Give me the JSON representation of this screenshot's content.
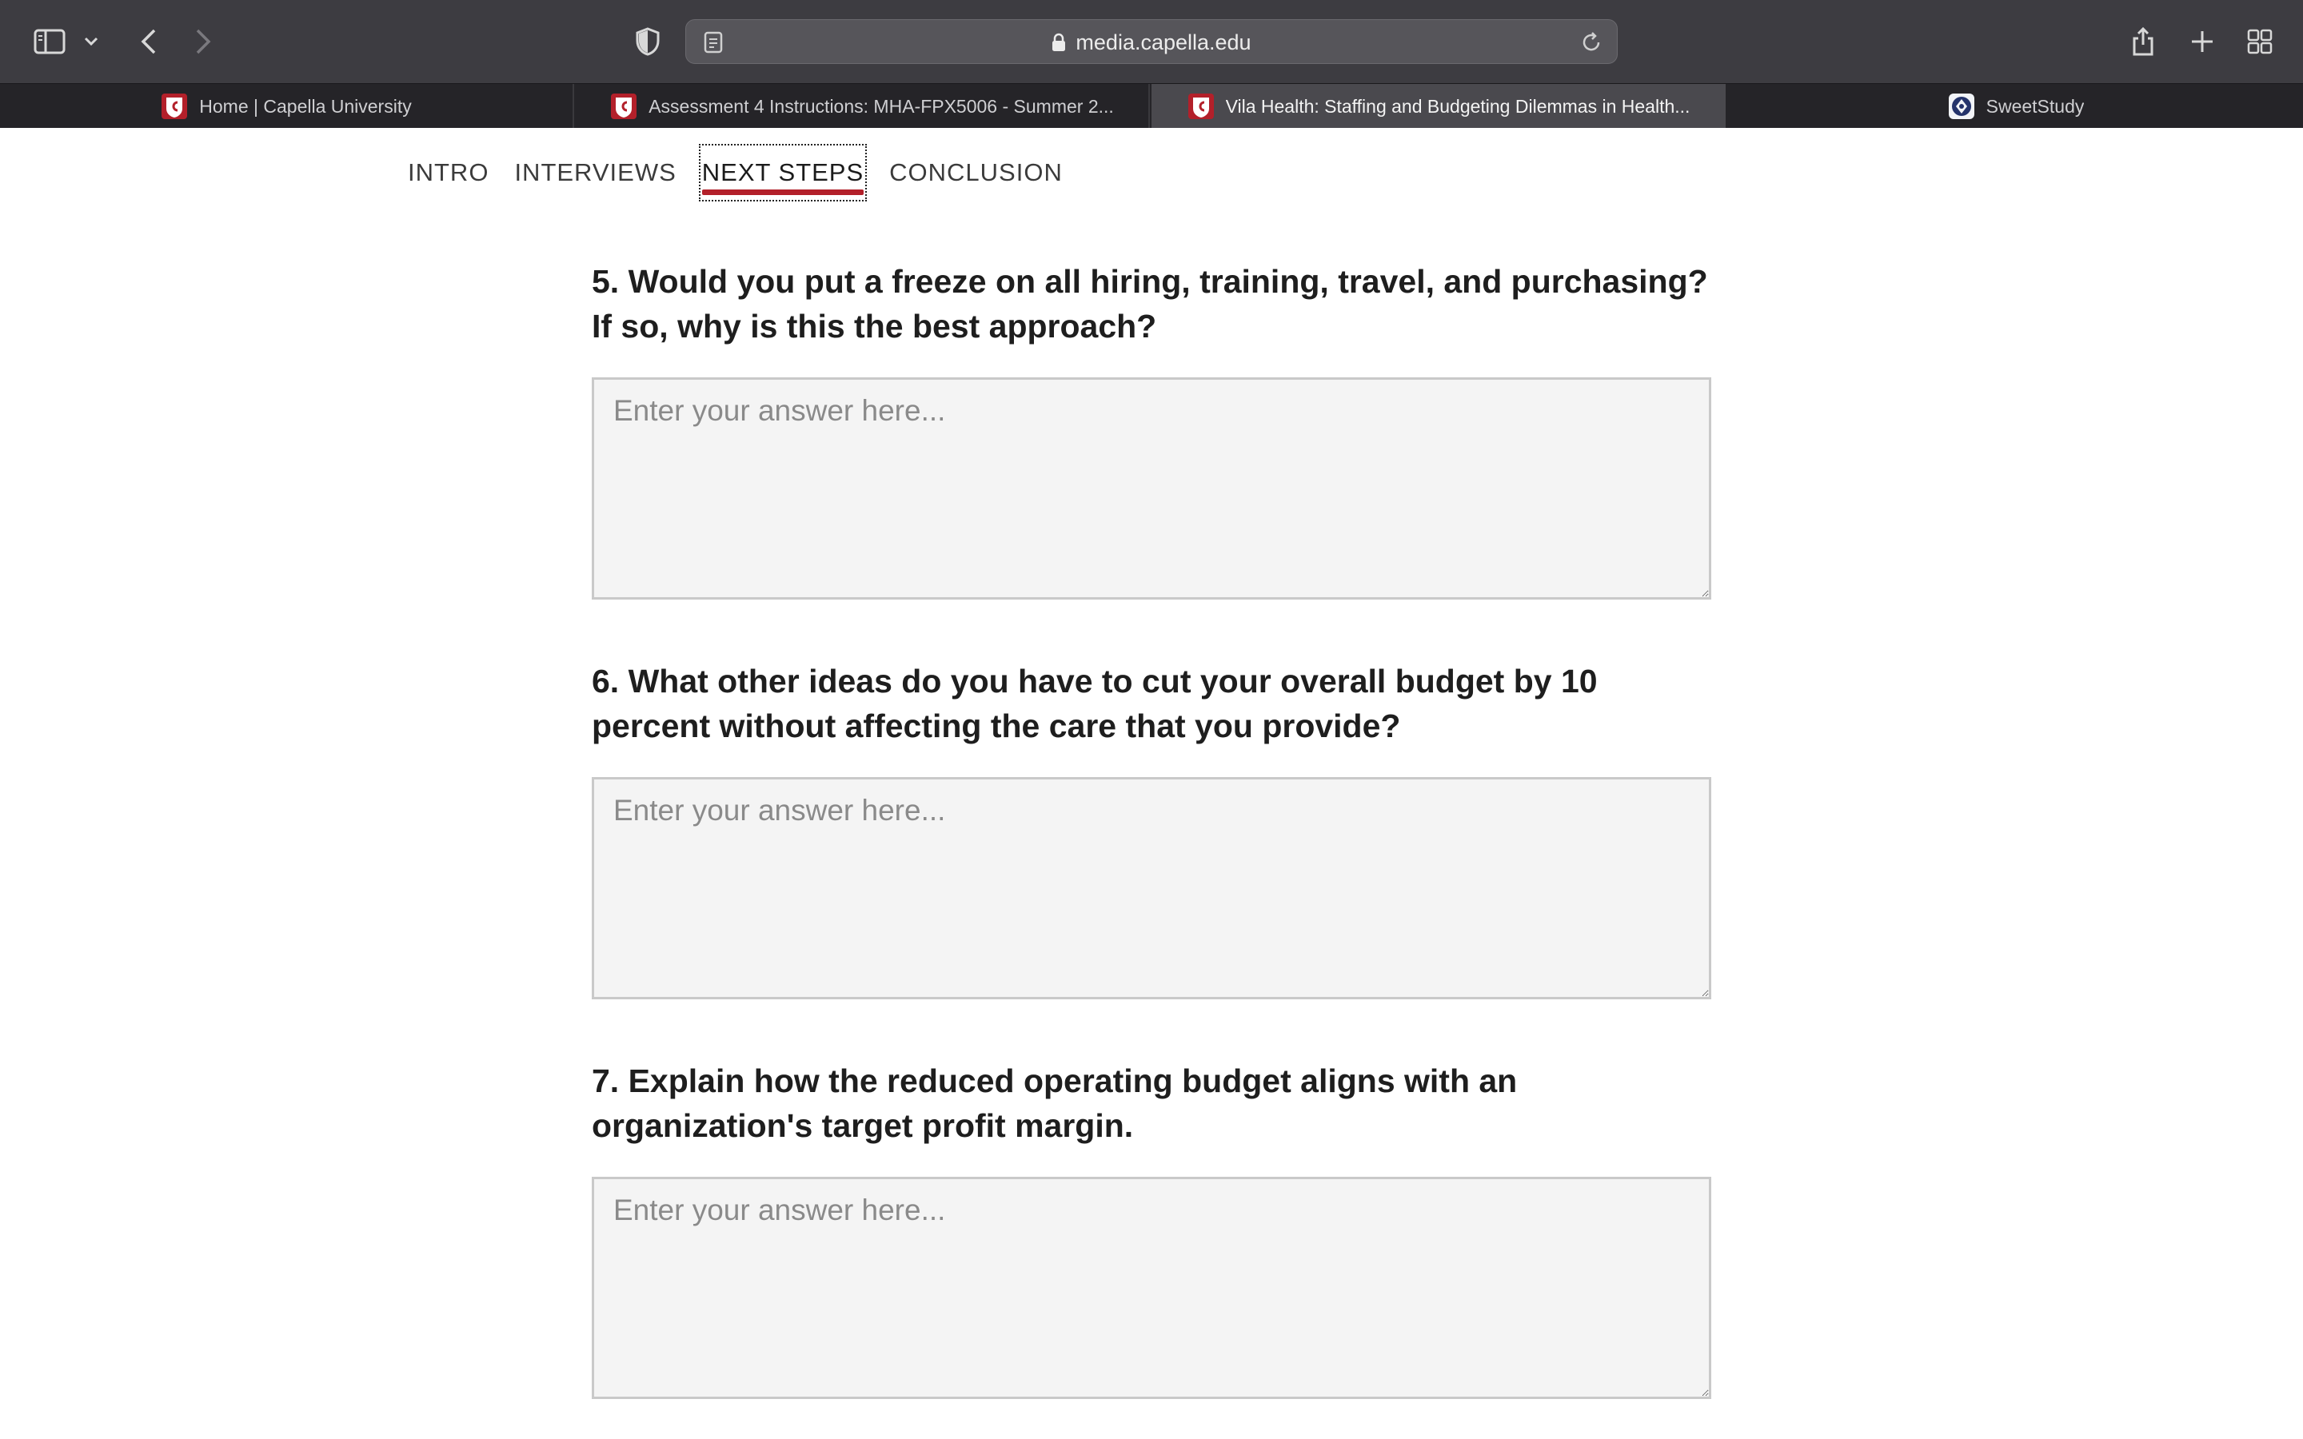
{
  "browser": {
    "url": "media.capella.edu",
    "icons": {
      "sidebar": "sidebar-icon",
      "chevron": "chevron-down-icon",
      "back": "back-arrow-icon",
      "forward": "forward-arrow-icon",
      "shield": "privacy-shield-icon",
      "reader": "page-icon",
      "lock": "lock-icon",
      "reload": "reload-icon",
      "share": "share-icon",
      "new_tab": "plus-icon",
      "tab_overview": "grid-icon"
    }
  },
  "tabs": [
    {
      "title": "Home | Capella University",
      "icon": "capella-favicon"
    },
    {
      "title": "Assessment 4 Instructions: MHA-FPX5006 - Summer 2...",
      "icon": "capella-favicon"
    },
    {
      "title": "Vila Health: Staffing and Budgeting Dilemmas in Health...",
      "icon": "capella-favicon",
      "active": true
    },
    {
      "title": "SweetStudy",
      "icon": "sweetstudy-favicon"
    }
  ],
  "nav": {
    "items": [
      "INTRO",
      "INTERVIEWS",
      "NEXT STEPS",
      "CONCLUSION"
    ],
    "active": "NEXT STEPS",
    "accent_color": "#b3202a"
  },
  "questions": [
    {
      "text": "5. Would you put a freeze on all hiring, training, travel, and purchasing? If so, why is this the best approach?",
      "placeholder": "Enter your answer here...",
      "value": ""
    },
    {
      "text": "6. What other ideas do you have to cut your overall budget by 10 percent without affecting the care that you provide?",
      "placeholder": "Enter your answer here...",
      "value": ""
    },
    {
      "text": "7. Explain how the reduced operating budget aligns with an organization's target profit margin.",
      "placeholder": "Enter your answer here...",
      "value": ""
    }
  ]
}
